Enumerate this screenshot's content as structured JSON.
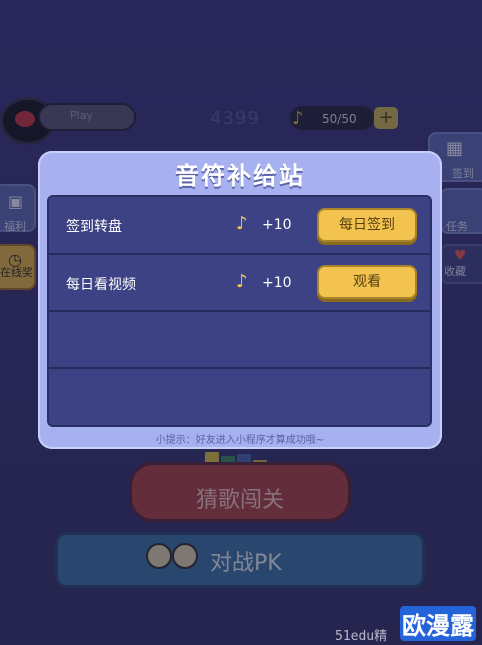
{
  "topbar": {
    "play_label": "Play",
    "score": "4399",
    "notes": "50/50",
    "plus": "+"
  },
  "side_left": [
    {
      "label": "福利"
    },
    {
      "label": "在线奖"
    }
  ],
  "side_right": [
    {
      "label": "签到"
    },
    {
      "label": "任务"
    },
    {
      "label": "收藏"
    }
  ],
  "background_buttons": {
    "guess": "猜歌闯关",
    "pk": "对战PK"
  },
  "modal": {
    "title": "音符补给站",
    "rows": [
      {
        "title": "签到转盘",
        "reward": "+10",
        "action": "每日签到"
      },
      {
        "title": "每日看视频",
        "reward": "+10",
        "action": "观看"
      }
    ],
    "tip": "小提示：好友进入小程序才算成功哦~"
  },
  "watermark": {
    "sub": "51edu精",
    "logo": "欧漫露"
  },
  "colors": {
    "background": "#3b3a7d",
    "modal": "#a7b1f0",
    "modal_inner": "#3c4283",
    "action": "#f2c44f",
    "note": "#f1cb46"
  },
  "icons": [
    "record-icon",
    "music-note-icon",
    "plus-icon",
    "calendar-icon",
    "gift-icon",
    "clock-icon",
    "heart-icon",
    "users-icon"
  ]
}
